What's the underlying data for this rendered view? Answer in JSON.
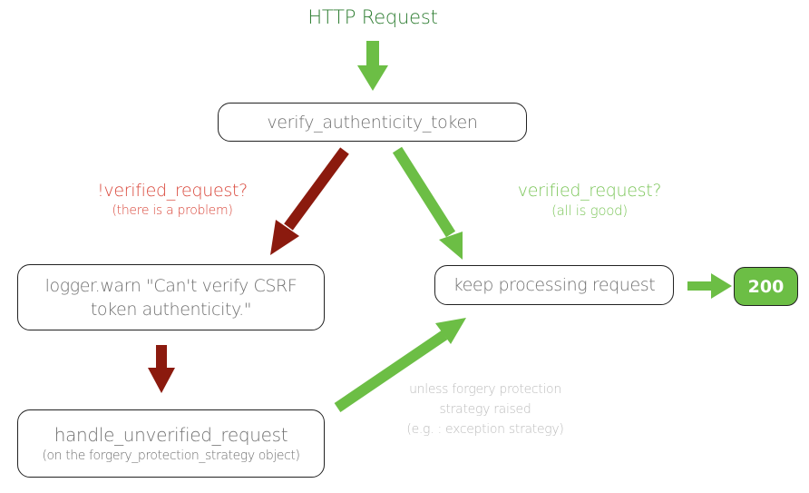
{
  "colors": {
    "green": "#6cbe45",
    "dark_red": "#8b1a0e",
    "title_green": "#2e7d32",
    "problem_red": "#d9473b",
    "ok_green": "#7cc65a",
    "note_gray": "#bdbdbd",
    "box_text_gray": "#707070"
  },
  "title": "HTTP Request",
  "nodes": {
    "verify": {
      "label": "verify_authenticity_token"
    },
    "logger": {
      "line1": "logger.warn \"Can't verify CSRF",
      "line2": "token authenticity.\""
    },
    "keep": {
      "label": "keep processing request"
    },
    "status": {
      "label": "200"
    },
    "handle": {
      "label": "handle_unverified_request",
      "sublabel": "(on the forgery_protection_strategy object)"
    }
  },
  "edge_labels": {
    "fail": {
      "label": "!verified_request?",
      "sublabel": "(there is a problem)"
    },
    "ok": {
      "label": "verified_request?",
      "sublabel": "(all is good)"
    },
    "unless": {
      "line1": "unless forgery protection",
      "line2": "strategy raised",
      "line3": "(e.g. : exception strategy)"
    }
  },
  "edges": [
    {
      "from": "http-request",
      "to": "verify",
      "color": "green"
    },
    {
      "from": "verify",
      "to": "logger",
      "color": "dark_red",
      "label": "fail"
    },
    {
      "from": "verify",
      "to": "keep",
      "color": "green",
      "label": "ok"
    },
    {
      "from": "logger",
      "to": "handle",
      "color": "dark_red"
    },
    {
      "from": "handle",
      "to": "keep",
      "color": "green",
      "label": "unless"
    },
    {
      "from": "keep",
      "to": "status",
      "color": "green"
    }
  ]
}
